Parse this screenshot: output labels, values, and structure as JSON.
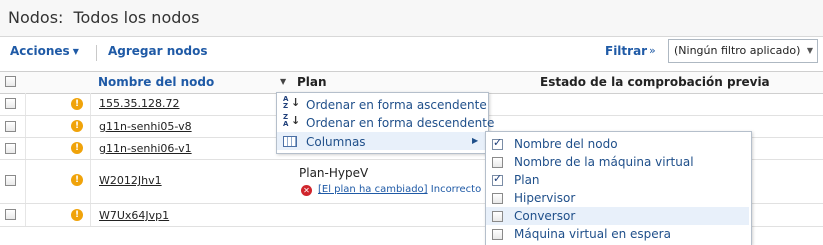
{
  "header": {
    "title_prefix": "Nodos:",
    "title_scope": "Todos los nodos"
  },
  "toolbar": {
    "actions_label": "Acciones",
    "add_nodes_label": "Agregar nodos",
    "filter_label": "Filtrar",
    "filter_value": "(Ningún filtro aplicado)"
  },
  "table": {
    "columns": [
      "Nombre del nodo",
      "Plan",
      "Estado de la comprobación previa"
    ],
    "rows": [
      {
        "name": "155.35.128.72",
        "plan": "",
        "status": ""
      },
      {
        "name": "g11n-senhi05-v8",
        "plan": "",
        "status": ""
      },
      {
        "name": "g11n-senhi06-v1",
        "plan": "",
        "status": ""
      },
      {
        "name": "W2012Jhv1",
        "plan": "Plan-HypeV",
        "plan_error_link": "[El plan ha cambiado]",
        "plan_error_text": "Incorrecto",
        "status": ""
      },
      {
        "name": "W7Ux64Jvp1",
        "plan": "",
        "status": ""
      }
    ]
  },
  "context_menu": {
    "items": [
      "Ordenar en forma ascendente",
      "Ordenar en forma descendente",
      "Columnas"
    ],
    "highlighted_index": 2
  },
  "columns_submenu": {
    "items": [
      {
        "label": "Nombre del nodo",
        "checked": true
      },
      {
        "label": "Nombre de la máquina virtual",
        "checked": false
      },
      {
        "label": "Plan",
        "checked": true
      },
      {
        "label": "Hipervisor",
        "checked": false
      },
      {
        "label": "Conversor",
        "checked": false
      },
      {
        "label": "Máquina virtual en espera",
        "checked": false
      }
    ],
    "highlighted_index": 4
  },
  "colors": {
    "link": "#1f5aa6",
    "warning": "#f0a30a",
    "error": "#d0252c",
    "menu_highlight": "#e8f0fa"
  }
}
